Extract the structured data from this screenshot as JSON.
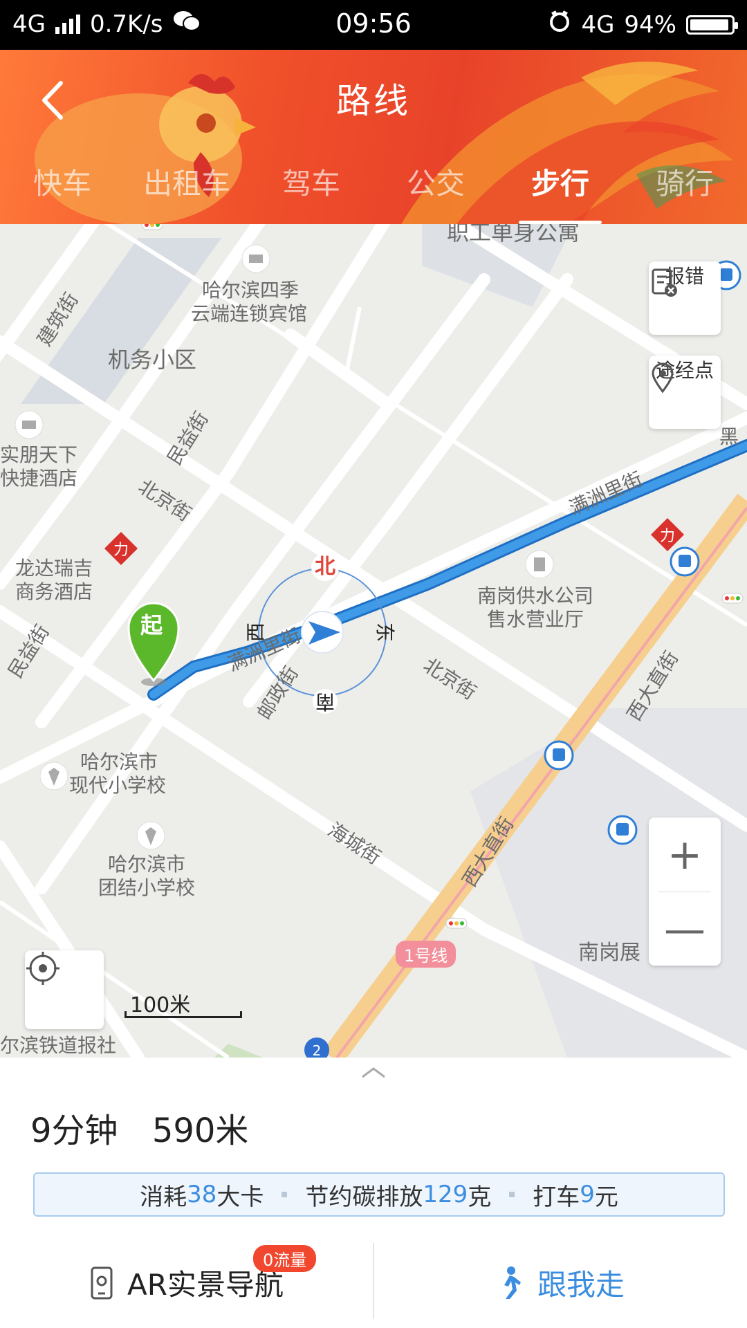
{
  "status_bar": {
    "network": "4G",
    "speed": "0.7K/s",
    "time": "09:56",
    "network_right": "4G",
    "battery": "94%",
    "battery_level": 0.94
  },
  "header": {
    "title": "路线",
    "tabs": [
      {
        "label": "快车",
        "active": false
      },
      {
        "label": "出租车",
        "active": false
      },
      {
        "label": "驾车",
        "active": false
      },
      {
        "label": "公交",
        "active": false
      },
      {
        "label": "步行",
        "active": true
      },
      {
        "label": "骑行",
        "active": false
      }
    ]
  },
  "map": {
    "labels": {
      "l1": "职工单身公寓",
      "l2a": "哈尔滨四季",
      "l2b": "云端连锁宾馆",
      "l3": "建筑街",
      "l4": "机务小区",
      "l5": "民益街",
      "l6a": "实朋天下",
      "l6b": "快捷酒店",
      "l7": "北京街",
      "l8a": "龙达瑞吉",
      "l8b": "商务酒店",
      "l9": "民益街",
      "l10": "满洲里街",
      "l11a": "南岗供水公司",
      "l11b": "售水营业厅",
      "l12": "满洲里街",
      "l13": "邮政街",
      "l14": "北京街",
      "l15": "西大直街",
      "l16a": "哈尔滨市",
      "l16b": "现代小学校",
      "l17a": "哈尔滨市",
      "l17b": "团结小学校",
      "l18": "海城街",
      "l19": "西大直街",
      "l20": "南岗展",
      "l21": "尔滨铁道报社",
      "l22": "黑"
    },
    "compass": {
      "n": "北",
      "e": "东",
      "s": "南",
      "w": "西"
    },
    "start_marker": "起",
    "line_badge": "1号线",
    "scale_label": "100米",
    "buttons": {
      "report": "报错",
      "waypoint": "途经点",
      "zoom_in": "+",
      "zoom_out": "—"
    }
  },
  "panel": {
    "duration": "9分钟",
    "distance": "590米",
    "info": {
      "p1": "消耗",
      "calories": "38",
      "p2": "大卡",
      "p3": "节约碳排放",
      "carbon": "129",
      "p4": "克",
      "p5": "打车",
      "fare": "9",
      "p6": "元"
    },
    "ar_label": "AR实景导航",
    "ar_badge": "0流量",
    "follow_label": "跟我走"
  },
  "colors": {
    "route": "#3f9be8",
    "header": "#ec4a2b",
    "accent": "#3b8de0",
    "start_marker": "#5cb82b"
  }
}
